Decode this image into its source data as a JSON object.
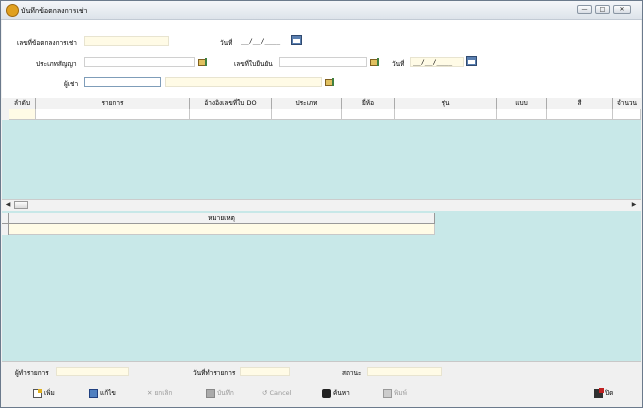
{
  "window": {
    "title": "บันทึกข้อตกลงการเช่า",
    "min_glyph": "—",
    "max_glyph": "□",
    "close_glyph": "✕"
  },
  "form": {
    "agreement_no_label": "เลขที่ข้อตกลงการเช่า",
    "agreement_no_value": "",
    "date1_label": "วันที่",
    "date1_value": "__/__/____",
    "contract_type_label": "ประเภทสัญญา",
    "contract_type_value": "",
    "confirm_no_label": "เลขที่ใบยืนยัน",
    "confirm_no_value": "",
    "date2_label": "วันที่",
    "date2_value": "__/__/____",
    "lessee_label": "ผู้เช่า",
    "lessee_code": "",
    "lessee_name": ""
  },
  "items_table": {
    "columns": [
      "ลำดับ",
      "รายการ",
      "อ้างอิงเลขที่ใบ DO",
      "ประเภท",
      "ยี่ห้อ",
      "รุ่น",
      "แบบ",
      "สี",
      "จำนวน"
    ],
    "rows": []
  },
  "notes_table": {
    "column": "หมายเหตุ",
    "rows": []
  },
  "footer": {
    "recorder_label": "ผู้ทำรายการ",
    "recorder_value": "",
    "record_date_label": "วันที่ทำรายการ",
    "record_date_value": "",
    "status_label": "สถานะ",
    "status_value": ""
  },
  "toolbar": {
    "add": "เพิ่ม",
    "edit": "แก้ไข",
    "cancel_item": "ยกเลิก",
    "save": "บันทึก",
    "cancel": "Cancel",
    "search": "ค้นหา",
    "print": "พิมพ์",
    "close": "ปิด"
  },
  "scroll": {
    "left_arrow": "◀",
    "right_arrow": "▶"
  },
  "colors": {
    "grid_background": "#c8e8e8",
    "field_background": "#fffbe6",
    "window_border": "#6b7a8c"
  },
  "icons": [
    "app-icon",
    "calendar-icon",
    "lookup-icon",
    "new-icon",
    "edit-icon",
    "cancel-x-icon",
    "save-icon",
    "undo-icon",
    "binoculars-icon",
    "print-icon",
    "exit-icon"
  ]
}
